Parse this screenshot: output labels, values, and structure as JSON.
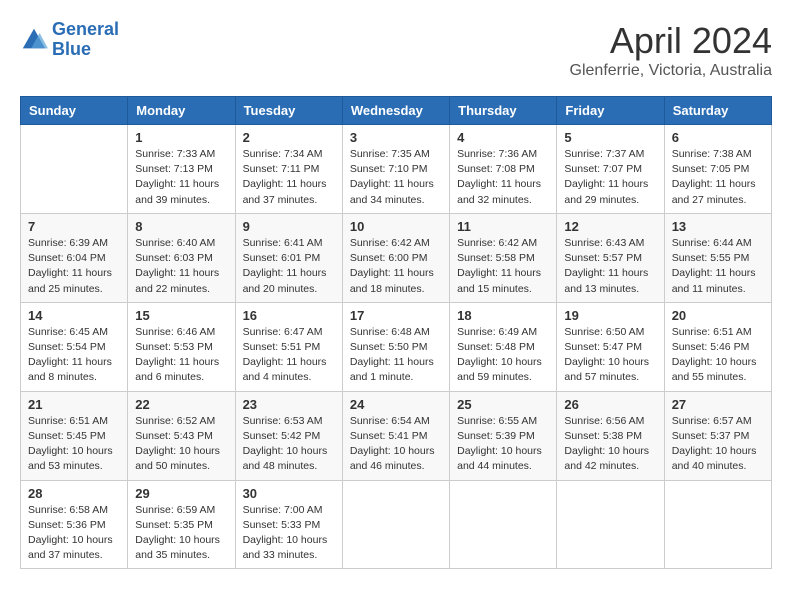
{
  "header": {
    "logo_line1": "General",
    "logo_line2": "Blue",
    "month_title": "April 2024",
    "subtitle": "Glenferrie, Victoria, Australia"
  },
  "days_of_week": [
    "Sunday",
    "Monday",
    "Tuesday",
    "Wednesday",
    "Thursday",
    "Friday",
    "Saturday"
  ],
  "weeks": [
    [
      {
        "day": "",
        "sunrise": "",
        "sunset": "",
        "daylight": ""
      },
      {
        "day": "1",
        "sunrise": "Sunrise: 7:33 AM",
        "sunset": "Sunset: 7:13 PM",
        "daylight": "Daylight: 11 hours and 39 minutes."
      },
      {
        "day": "2",
        "sunrise": "Sunrise: 7:34 AM",
        "sunset": "Sunset: 7:11 PM",
        "daylight": "Daylight: 11 hours and 37 minutes."
      },
      {
        "day": "3",
        "sunrise": "Sunrise: 7:35 AM",
        "sunset": "Sunset: 7:10 PM",
        "daylight": "Daylight: 11 hours and 34 minutes."
      },
      {
        "day": "4",
        "sunrise": "Sunrise: 7:36 AM",
        "sunset": "Sunset: 7:08 PM",
        "daylight": "Daylight: 11 hours and 32 minutes."
      },
      {
        "day": "5",
        "sunrise": "Sunrise: 7:37 AM",
        "sunset": "Sunset: 7:07 PM",
        "daylight": "Daylight: 11 hours and 29 minutes."
      },
      {
        "day": "6",
        "sunrise": "Sunrise: 7:38 AM",
        "sunset": "Sunset: 7:05 PM",
        "daylight": "Daylight: 11 hours and 27 minutes."
      }
    ],
    [
      {
        "day": "7",
        "sunrise": "Sunrise: 6:39 AM",
        "sunset": "Sunset: 6:04 PM",
        "daylight": "Daylight: 11 hours and 25 minutes."
      },
      {
        "day": "8",
        "sunrise": "Sunrise: 6:40 AM",
        "sunset": "Sunset: 6:03 PM",
        "daylight": "Daylight: 11 hours and 22 minutes."
      },
      {
        "day": "9",
        "sunrise": "Sunrise: 6:41 AM",
        "sunset": "Sunset: 6:01 PM",
        "daylight": "Daylight: 11 hours and 20 minutes."
      },
      {
        "day": "10",
        "sunrise": "Sunrise: 6:42 AM",
        "sunset": "Sunset: 6:00 PM",
        "daylight": "Daylight: 11 hours and 18 minutes."
      },
      {
        "day": "11",
        "sunrise": "Sunrise: 6:42 AM",
        "sunset": "Sunset: 5:58 PM",
        "daylight": "Daylight: 11 hours and 15 minutes."
      },
      {
        "day": "12",
        "sunrise": "Sunrise: 6:43 AM",
        "sunset": "Sunset: 5:57 PM",
        "daylight": "Daylight: 11 hours and 13 minutes."
      },
      {
        "day": "13",
        "sunrise": "Sunrise: 6:44 AM",
        "sunset": "Sunset: 5:55 PM",
        "daylight": "Daylight: 11 hours and 11 minutes."
      }
    ],
    [
      {
        "day": "14",
        "sunrise": "Sunrise: 6:45 AM",
        "sunset": "Sunset: 5:54 PM",
        "daylight": "Daylight: 11 hours and 8 minutes."
      },
      {
        "day": "15",
        "sunrise": "Sunrise: 6:46 AM",
        "sunset": "Sunset: 5:53 PM",
        "daylight": "Daylight: 11 hours and 6 minutes."
      },
      {
        "day": "16",
        "sunrise": "Sunrise: 6:47 AM",
        "sunset": "Sunset: 5:51 PM",
        "daylight": "Daylight: 11 hours and 4 minutes."
      },
      {
        "day": "17",
        "sunrise": "Sunrise: 6:48 AM",
        "sunset": "Sunset: 5:50 PM",
        "daylight": "Daylight: 11 hours and 1 minute."
      },
      {
        "day": "18",
        "sunrise": "Sunrise: 6:49 AM",
        "sunset": "Sunset: 5:48 PM",
        "daylight": "Daylight: 10 hours and 59 minutes."
      },
      {
        "day": "19",
        "sunrise": "Sunrise: 6:50 AM",
        "sunset": "Sunset: 5:47 PM",
        "daylight": "Daylight: 10 hours and 57 minutes."
      },
      {
        "day": "20",
        "sunrise": "Sunrise: 6:51 AM",
        "sunset": "Sunset: 5:46 PM",
        "daylight": "Daylight: 10 hours and 55 minutes."
      }
    ],
    [
      {
        "day": "21",
        "sunrise": "Sunrise: 6:51 AM",
        "sunset": "Sunset: 5:45 PM",
        "daylight": "Daylight: 10 hours and 53 minutes."
      },
      {
        "day": "22",
        "sunrise": "Sunrise: 6:52 AM",
        "sunset": "Sunset: 5:43 PM",
        "daylight": "Daylight: 10 hours and 50 minutes."
      },
      {
        "day": "23",
        "sunrise": "Sunrise: 6:53 AM",
        "sunset": "Sunset: 5:42 PM",
        "daylight": "Daylight: 10 hours and 48 minutes."
      },
      {
        "day": "24",
        "sunrise": "Sunrise: 6:54 AM",
        "sunset": "Sunset: 5:41 PM",
        "daylight": "Daylight: 10 hours and 46 minutes."
      },
      {
        "day": "25",
        "sunrise": "Sunrise: 6:55 AM",
        "sunset": "Sunset: 5:39 PM",
        "daylight": "Daylight: 10 hours and 44 minutes."
      },
      {
        "day": "26",
        "sunrise": "Sunrise: 6:56 AM",
        "sunset": "Sunset: 5:38 PM",
        "daylight": "Daylight: 10 hours and 42 minutes."
      },
      {
        "day": "27",
        "sunrise": "Sunrise: 6:57 AM",
        "sunset": "Sunset: 5:37 PM",
        "daylight": "Daylight: 10 hours and 40 minutes."
      }
    ],
    [
      {
        "day": "28",
        "sunrise": "Sunrise: 6:58 AM",
        "sunset": "Sunset: 5:36 PM",
        "daylight": "Daylight: 10 hours and 37 minutes."
      },
      {
        "day": "29",
        "sunrise": "Sunrise: 6:59 AM",
        "sunset": "Sunset: 5:35 PM",
        "daylight": "Daylight: 10 hours and 35 minutes."
      },
      {
        "day": "30",
        "sunrise": "Sunrise: 7:00 AM",
        "sunset": "Sunset: 5:33 PM",
        "daylight": "Daylight: 10 hours and 33 minutes."
      },
      {
        "day": "",
        "sunrise": "",
        "sunset": "",
        "daylight": ""
      },
      {
        "day": "",
        "sunrise": "",
        "sunset": "",
        "daylight": ""
      },
      {
        "day": "",
        "sunrise": "",
        "sunset": "",
        "daylight": ""
      },
      {
        "day": "",
        "sunrise": "",
        "sunset": "",
        "daylight": ""
      }
    ]
  ]
}
